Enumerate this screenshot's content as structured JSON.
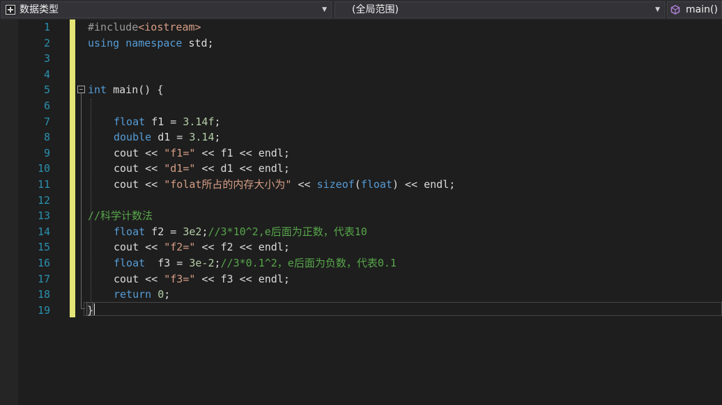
{
  "navbar": {
    "project": "数据类型",
    "scope": "(全局范围)",
    "member": "main()"
  },
  "line_numbers": [
    "1",
    "2",
    "3",
    "4",
    "5",
    "6",
    "7",
    "8",
    "9",
    "10",
    "11",
    "12",
    "13",
    "14",
    "15",
    "16",
    "17",
    "18",
    "19"
  ],
  "code": {
    "l1": {
      "directive": "#include",
      "header": "<iostream>"
    },
    "l2": {
      "kw1": "using",
      "kw2": "namespace",
      "rest": " std;"
    },
    "l5": {
      "kw": "int",
      "rest": " main() {"
    },
    "l7": {
      "type": "float",
      "rest": " f1 = ",
      "num": "3.14f",
      "end": ";"
    },
    "l8": {
      "type": "double",
      "rest": " d1 = ",
      "num": "3.14",
      "end": ";"
    },
    "l9": {
      "pre": "cout << ",
      "str": "\"f1=\"",
      "post": " << f1 << endl;"
    },
    "l10": {
      "pre": "cout << ",
      "str": "\"d1=\"",
      "post": " << d1 << endl;"
    },
    "l11": {
      "pre": "cout << ",
      "str": "\"folat所占的内存大小为\"",
      "mid": " << ",
      "kw": "sizeof",
      "paren_open": "(",
      "type": "float",
      "post": ") << endl;"
    },
    "l13": {
      "comment": "//科学计数法"
    },
    "l14": {
      "type": "float",
      "rest": " f2 = ",
      "num": "3e2",
      "end": ";",
      "comment": "//3*10^2,e后面为正数，代表10"
    },
    "l15": {
      "pre": "cout << ",
      "str": "\"f2=\"",
      "post": " << f2 << endl;"
    },
    "l16": {
      "type": "float",
      "rest": "  f3 = ",
      "num": "3e-2",
      "end": ";",
      "comment": "//3*0.1^2，e后面为负数，代表0.1"
    },
    "l17": {
      "pre": "cout << ",
      "str": "\"f3=\"",
      "post": " << f3 << endl;"
    },
    "l18": {
      "kw": "return",
      "rest": " ",
      "num": "0",
      "end": ";"
    },
    "l19": {
      "brace": "}"
    }
  },
  "colors": {
    "keyword": "#569cd6",
    "string": "#d69d85",
    "comment": "#57a64a",
    "line_number": "#2b91af",
    "change_bar": "#e4e477"
  }
}
